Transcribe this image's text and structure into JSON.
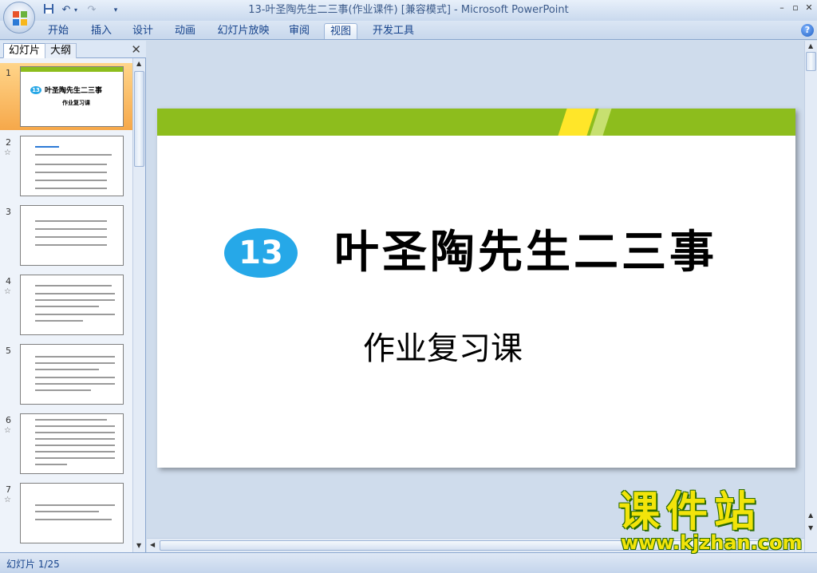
{
  "window": {
    "title": "13-叶圣陶先生二三事(作业课件) [兼容模式] - Microsoft PowerPoint"
  },
  "ribbon": {
    "tabs": [
      {
        "label": "开始"
      },
      {
        "label": "插入"
      },
      {
        "label": "设计"
      },
      {
        "label": "动画"
      },
      {
        "label": "幻灯片放映"
      },
      {
        "label": "审阅"
      },
      {
        "label": "视图",
        "active": true
      },
      {
        "label": "开发工具"
      }
    ]
  },
  "left_panel": {
    "tab_slides": "幻灯片",
    "tab_outline": "大纲",
    "close": "✕",
    "thumbnails": [
      {
        "num": "1",
        "star": "",
        "title": "叶圣陶先生二三事",
        "badge": "13",
        "sub": "作业复习课"
      },
      {
        "num": "2",
        "star": "☆"
      },
      {
        "num": "3",
        "star": ""
      },
      {
        "num": "4",
        "star": "☆"
      },
      {
        "num": "5",
        "star": ""
      },
      {
        "num": "6",
        "star": "☆"
      },
      {
        "num": "7",
        "star": "☆"
      }
    ]
  },
  "slide": {
    "badge": "13",
    "title": "叶圣陶先生二三事",
    "subtitle": "作业复习课"
  },
  "status": {
    "slide_counter": "幻灯片 1/25"
  },
  "watermark": {
    "brand": "课件站",
    "url": "www.kjzhan.com"
  },
  "colors": {
    "slide_bar": "#8dbd1d",
    "slide_stripe": "#ffe629",
    "badge": "#26a8e8",
    "selection": "#f6a84a"
  }
}
